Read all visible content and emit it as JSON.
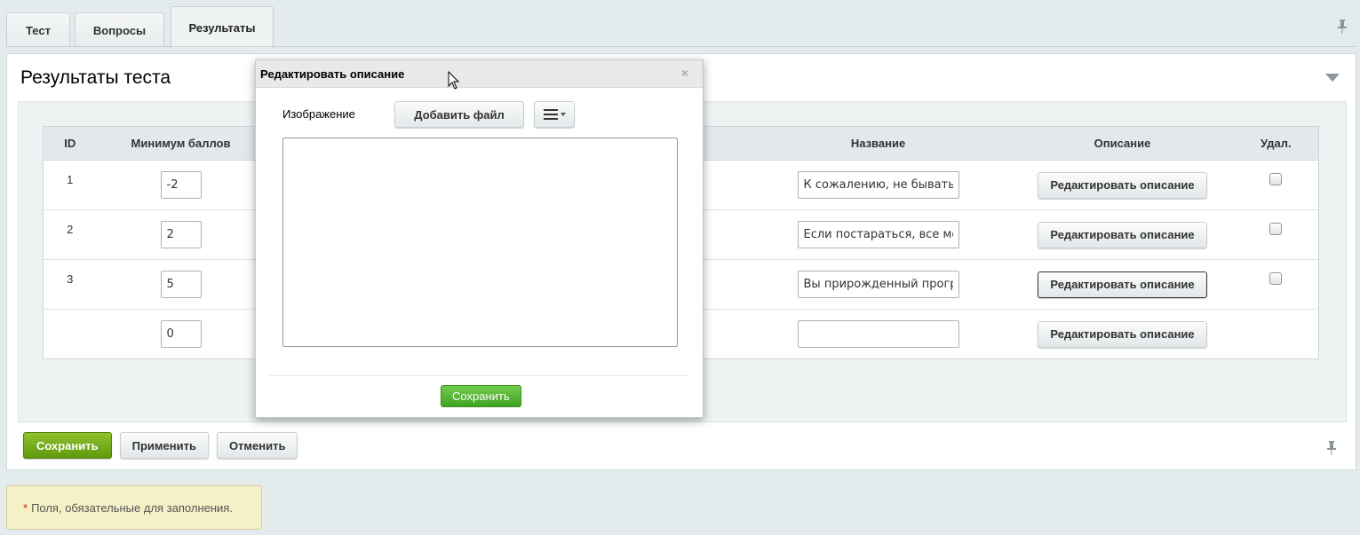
{
  "tabs": [
    {
      "label": "Тест"
    },
    {
      "label": "Вопросы"
    },
    {
      "label": "Результаты",
      "active": true
    }
  ],
  "panel": {
    "title": "Результаты теста"
  },
  "table": {
    "headers": {
      "id": "ID",
      "min_score": "Минимум баллов",
      "name": "Название",
      "description": "Описание",
      "delete": "Удал."
    },
    "rows": [
      {
        "id": "1",
        "min_score": "-2",
        "name": "К сожалению, не бывать",
        "desc_button": "Редактировать описание",
        "has_delete": true
      },
      {
        "id": "2",
        "min_score": "2",
        "name": "Если постараться, все мо",
        "desc_button": "Редактировать описание",
        "has_delete": true
      },
      {
        "id": "3",
        "min_score": "5",
        "name": "Вы прирожденный прогр",
        "desc_button": "Редактировать описание",
        "has_delete": true
      },
      {
        "id": "",
        "min_score": "0",
        "name": "",
        "desc_button": "Редактировать описание",
        "has_delete": false
      }
    ]
  },
  "footer": {
    "save": "Сохранить",
    "apply": "Применить",
    "cancel": "Отменить"
  },
  "note": {
    "star": "*",
    "text": "Поля, обязательные для заполнения."
  },
  "dialog": {
    "title": "Редактировать описание",
    "close": "×",
    "image_label": "Изображение",
    "add_file": "Добавить файл",
    "save": "Сохранить"
  },
  "colors": {
    "accent_green": "#6aa617",
    "dialog_green": "#4fb52f",
    "background": "#e4ebed"
  }
}
